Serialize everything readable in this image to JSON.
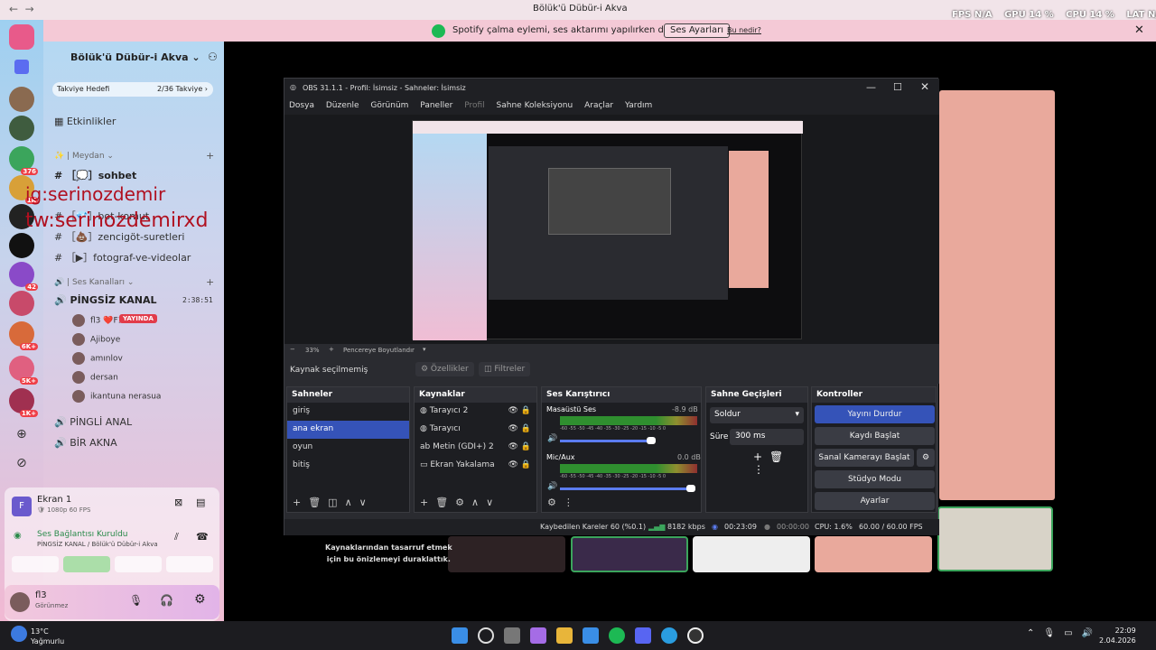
{
  "window_title": "Bölük'ü Dübür-i Akva",
  "overlay_stats": [
    "FPS N/A",
    "GPU 14 %",
    "CPU 14 %",
    "LAT N/A"
  ],
  "banner": {
    "text": "Spotify çalma eylemi, ses aktarımı yapılırken durduruldu.",
    "button": "Ses Ayarları",
    "link": "Bu nedir?",
    "close": "✕"
  },
  "guild_badges": [
    "376",
    "1K",
    "42",
    "6K+",
    "5K+",
    "1K+"
  ],
  "server": {
    "name": "Bölük'ü Dübür-i Akva ⌄",
    "goal_label": "Takviye Hedefi",
    "goal_value": "2/36 Takviye ›"
  },
  "channels": {
    "events": "Etkinlikler",
    "cat_meydan": "✨ | Meydan ⌄",
    "sohbet": "［💭］sohbet",
    "bot": "［💎］bot-komut",
    "zencigot": "［💩］zencigöt-suretleri",
    "foto": "［▶］fotograf-ve-videolar",
    "cat_ses": "🔊 | Ses Kanalları ⌄",
    "pingsiz": "PİNGSİZ KANAL",
    "pingsiz_time": "2:38:51",
    "users": [
      "ﬂ3 ❤️F1",
      "Ajiboye",
      "amınlov",
      "dersan",
      "ikantuna nerasua"
    ],
    "live": "YAYINDA",
    "pingli": "PİNGLİ ANAL",
    "bir": "BİR AKNA"
  },
  "watermark": [
    "ig:serinozdemir",
    "tw:serinozdemirxd"
  ],
  "stream_panel": {
    "title": "Ekran 1",
    "sub": "🛡 1080p 60 FPS",
    "voice": "Ses Bağlantısı Kuruldu",
    "voice_sub": "PİNGSİZ KANAL / Bölük'ü Dübür-i Akva"
  },
  "user": {
    "name": "ﬂ3",
    "status": "Görünmez"
  },
  "pause_text": [
    "Kaynaklarından tasarruf etmek",
    "için bu önizlemeyi duraklattık."
  ],
  "obs": {
    "title": "OBS 31.1.1 - Profil: İsimsiz - Sahneler: İsimsiz",
    "menu": [
      "Dosya",
      "Düzenle",
      "Görünüm",
      "Paneller",
      "Profil",
      "Sahne Koleksiyonu",
      "Araçlar",
      "Yardım"
    ],
    "zoom": "33%",
    "zoom_label": "Pencereye Boyutlandır",
    "no_source": "Kaynak seçilmemiş",
    "props": "⚙ Özellikler",
    "filters": "◫ Filtreler",
    "scenes_title": "Sahneler",
    "scenes": [
      "giriş",
      "ana ekran",
      "oyun",
      "bitiş"
    ],
    "sources_title": "Kaynaklar",
    "sources": [
      "Tarayıcı 2",
      "Tarayıcı",
      "Metin (GDI+) 2",
      "Ekran Yakalama"
    ],
    "mixer_title": "Ses Karıştırıcı",
    "mixer": [
      {
        "name": "Masaüstü Ses",
        "db": "-8.9 dB"
      },
      {
        "name": "Mic/Aux",
        "db": "0.0 dB"
      }
    ],
    "meter_scale": "-60 -55 -50 -45 -40 -35 -30 -25 -20 -15 -10 -5 0",
    "trans_title": "Sahne Geçişleri",
    "trans": "Soldur",
    "dur_label": "Süre",
    "dur": "300 ms",
    "ctrl_title": "Kontroller",
    "ctrl": [
      "Yayını Durdur",
      "Kaydı Başlat",
      "Sanal Kamerayı Başlat",
      "Stüdyo Modu",
      "Ayarlar"
    ],
    "status": {
      "dropped": "Kaybedilen Kareler 60 (%0.1)",
      "kbps": "8182 kbps",
      "stream_time": "00:23:09",
      "rec_time": "00:00:00",
      "cpu": "CPU: 1.6%",
      "fps": "60.00 / 60.00 FPS"
    }
  },
  "taskbar": {
    "temp": "13°C",
    "weather": "Yağmurlu",
    "time": "22:09",
    "date": "2.04.2026"
  },
  "colors": {
    "accent": "#3553b8",
    "discord_live": "#e23c4a",
    "banner": "#f4c9d6"
  }
}
